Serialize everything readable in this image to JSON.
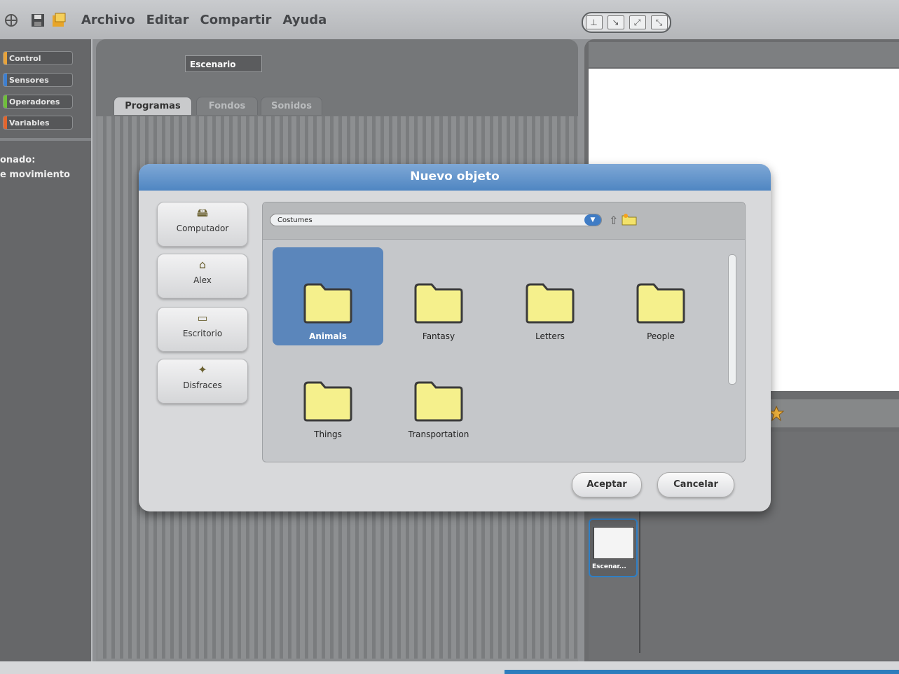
{
  "menubar": {
    "items": [
      "Archivo",
      "Editar",
      "Compartir",
      "Ayuda"
    ]
  },
  "palette": {
    "categories": [
      {
        "label": "Control",
        "color": "#e8a33a"
      },
      {
        "label": "Sensores",
        "color": "#3d7fd1"
      },
      {
        "label": "Operadores",
        "color": "#6fbf3a"
      },
      {
        "label": "Variables",
        "color": "#e3652d"
      }
    ],
    "side_text_1": "onado:",
    "side_text_2": "e movimiento"
  },
  "scripts": {
    "sprite_name": "Escenario",
    "tabs": [
      "Programas",
      "Fondos",
      "Sonidos"
    ]
  },
  "stage": {
    "thumb_label": "Escenar..."
  },
  "dialog": {
    "title": "Nuevo objeto",
    "places": [
      {
        "label": "Computador",
        "icon": "computer-icon"
      },
      {
        "label": "Alex",
        "icon": "home-icon"
      },
      {
        "label": "Escritorio",
        "icon": "desktop-icon"
      },
      {
        "label": "Disfraces",
        "icon": "costumes-icon"
      }
    ],
    "path": "Costumes",
    "folders": [
      {
        "name": "Animals",
        "selected": true
      },
      {
        "name": "Fantasy",
        "selected": false
      },
      {
        "name": "Letters",
        "selected": false
      },
      {
        "name": "People",
        "selected": false
      },
      {
        "name": "Things",
        "selected": false
      },
      {
        "name": "Transportation",
        "selected": false
      }
    ],
    "ok_label": "Aceptar",
    "cancel_label": "Cancelar"
  }
}
